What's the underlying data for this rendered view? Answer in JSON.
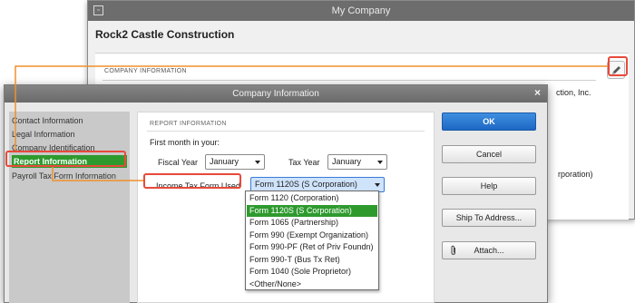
{
  "background_window": {
    "title": "My Company",
    "company_name": "Rock2 Castle Construction",
    "section_header": "COMPANY INFORMATION",
    "partial_text_1": "ction, Inc.",
    "partial_text_2": "rporation)",
    "edit_icon": "pencil-icon"
  },
  "dialog": {
    "title": "Company Information",
    "close_glyph": "×",
    "nav": [
      {
        "label": "Contact Information"
      },
      {
        "label": "Legal Information"
      },
      {
        "label": "Company Identification"
      },
      {
        "label": "Report Information",
        "active": true
      },
      {
        "label": "Payroll Tax Form Information"
      }
    ],
    "panel": {
      "header": "REPORT INFORMATION",
      "first_month_label": "First month in your:",
      "fiscal_year_label": "Fiscal Year",
      "fiscal_year_value": "January",
      "tax_year_label": "Tax Year",
      "tax_year_value": "January",
      "tax_form_label": "Income Tax Form Used",
      "tax_form_value": "Form 1120S (S Corporation)",
      "tax_form_options": [
        "Form 1120 (Corporation)",
        "Form 1120S (S Corporation)",
        "Form 1065 (Partnership)",
        "Form 990 (Exempt Organization)",
        "Form 990-PF (Ret of Priv Foundn)",
        "Form 990-T (Bus Tx Ret)",
        "Form 1040 (Sole Proprietor)",
        "<Other/None>"
      ],
      "selected_option_index": 1
    },
    "buttons": {
      "ok": "OK",
      "cancel": "Cancel",
      "help": "Help",
      "ship_to": "Ship To Address...",
      "attach": "Attach..."
    }
  },
  "colors": {
    "highlight": "#e84a3a",
    "connector": "#f0902a",
    "selection_green": "#2e9a2e",
    "ok_blue": "#1d67c4"
  }
}
